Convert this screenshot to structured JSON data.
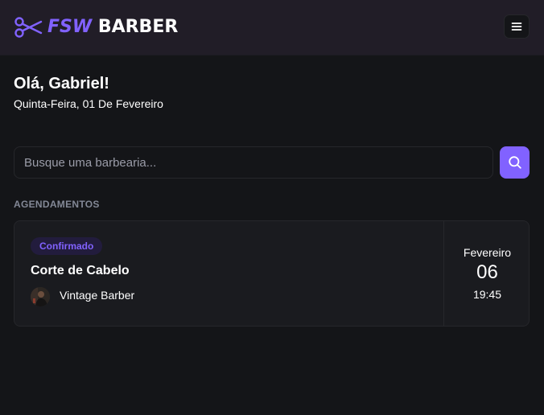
{
  "header": {
    "logo_accent": "FSW",
    "logo_main": "BARBER",
    "logo_icon": "scissors-icon",
    "menu_icon": "menu-icon"
  },
  "welcome": {
    "greeting": "Olá, Gabriel!",
    "date": "Quinta-Feira, 01 De Fevereiro"
  },
  "search": {
    "placeholder": "Busque uma barbearia...",
    "value": "",
    "button_icon": "search-icon"
  },
  "bookings": {
    "section_title": "AGENDAMENTOS",
    "items": [
      {
        "status": "Confirmado",
        "service": "Corte de Cabelo",
        "barbershop": "Vintage Barber",
        "month": "Fevereiro",
        "day": "06",
        "time": "19:45"
      }
    ]
  },
  "colors": {
    "background": "#141518",
    "header": "#211d27",
    "primary": "#8162ff",
    "card": "#1a1b1f",
    "border": "#26272b",
    "muted": "#838896"
  }
}
